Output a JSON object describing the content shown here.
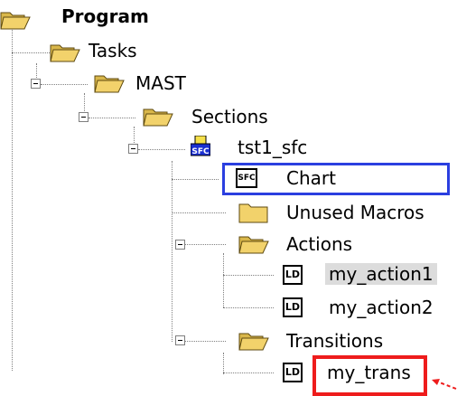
{
  "tree": {
    "root": "Program",
    "tasks": "Tasks",
    "mast": "MAST",
    "sections": "Sections",
    "section_name": "tst1_sfc",
    "chart": "Chart",
    "unused_macros": "Unused Macros",
    "actions": "Actions",
    "action1": "my_action1",
    "action2": "my_action2",
    "transitions": "Transitions",
    "transition1": "my_trans"
  },
  "icons": {
    "folder": "folder-icon",
    "open_folder": "open-folder-icon",
    "sfc_section": "sfc-section-icon",
    "sfc_chart": "sfc-chart-icon",
    "ld": "ld-icon"
  },
  "labels_on_icons": {
    "sfc": "SFC",
    "ld": "LD",
    "sfc_chart": "SFC"
  },
  "colors": {
    "highlight_blue": "#2b3fe0",
    "highlight_red": "#ee1c1c",
    "selected_bg": "#dcdcdc",
    "folder_yellow": "#f2d26b"
  }
}
